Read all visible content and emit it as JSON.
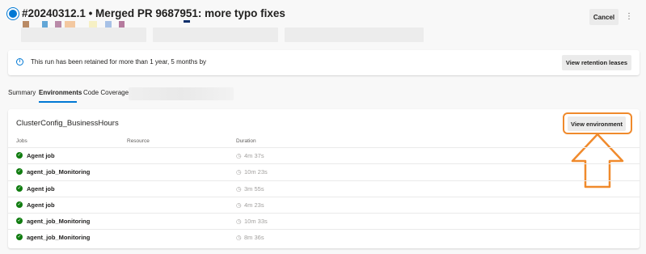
{
  "header": {
    "title": "#20240312.1 • Merged PR 9687951: more typo fixes",
    "cancel_label": "Cancel",
    "more_glyph": "⋮",
    "swatch_colors": [
      "#b98a64",
      "#62a6d6",
      "#b98aa8",
      "#f3c8a0",
      "#f6f0c4",
      "#a7c1e6",
      "#b57a9e"
    ]
  },
  "banner": {
    "info_glyph": "i",
    "message": "This run has been retained for more than 1 year, 5 months by",
    "button_label": "View retention leases"
  },
  "tabs": [
    {
      "label": "Summary",
      "active": false
    },
    {
      "label": "Environments",
      "active": true
    },
    {
      "label": "Code Coverage",
      "active": false
    }
  ],
  "environment": {
    "name": "ClusterConfig_BusinessHours",
    "view_button_label": "View environment",
    "columns": {
      "jobs": "Jobs",
      "resource": "Resource",
      "duration": "Duration"
    },
    "jobs": [
      {
        "name": "Agent job",
        "duration": "4m 37s",
        "status": "succeeded"
      },
      {
        "name": "agent_job_Monitoring",
        "duration": "10m 23s",
        "status": "succeeded"
      },
      {
        "name": "Agent job",
        "duration": "3m 55s",
        "status": "succeeded"
      },
      {
        "name": "Agent job",
        "duration": "4m 23s",
        "status": "succeeded"
      },
      {
        "name": "agent_job_Monitoring",
        "duration": "10m 33s",
        "status": "succeeded"
      },
      {
        "name": "agent_job_Monitoring",
        "duration": "8m 36s",
        "status": "succeeded"
      }
    ]
  },
  "icons": {
    "run": "pipeline-run-icon",
    "info": "info-icon",
    "success": "success-check-icon",
    "clock": "clock-icon",
    "annotation": "up-arrow-annotation"
  },
  "colors": {
    "accent": "#0078d4",
    "success": "#107c10",
    "annotation": "#f08a2c"
  }
}
